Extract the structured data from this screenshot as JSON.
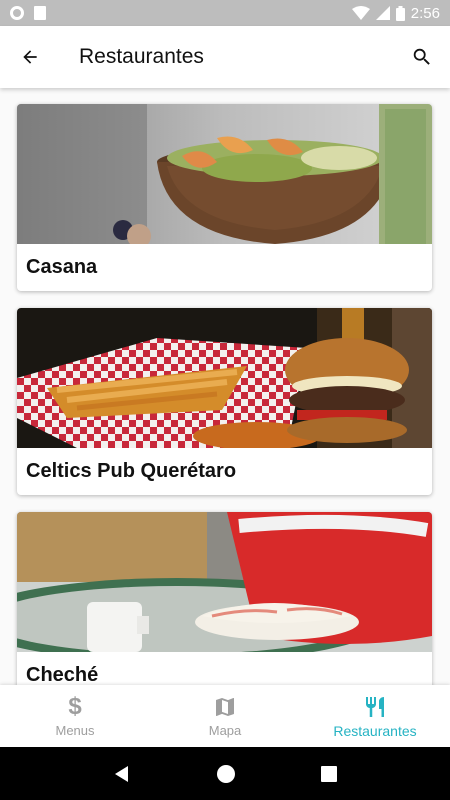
{
  "status_bar": {
    "time": "2:56"
  },
  "app_bar": {
    "title": "Restaurantes"
  },
  "restaurants": [
    {
      "name": "Casana"
    },
    {
      "name": "Celtics Pub Querétaro"
    },
    {
      "name": "Cheché"
    }
  ],
  "bottom_nav": {
    "items": [
      {
        "label": "Menus",
        "icon": "dollar-icon",
        "active": false
      },
      {
        "label": "Mapa",
        "icon": "map-icon",
        "active": false
      },
      {
        "label": "Restaurantes",
        "icon": "fork-knife-icon",
        "active": true
      }
    ]
  },
  "colors": {
    "accent": "#26b3c3",
    "inactive": "#9e9e9e",
    "status_bar": "#bdbdbd"
  }
}
